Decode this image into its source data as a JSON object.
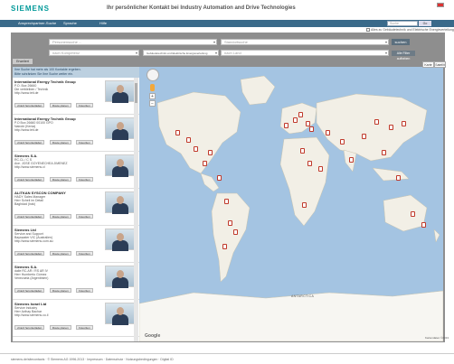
{
  "header": {
    "logo": "SIEMENS",
    "tagline": "Ihr persönlicher Kontakt bei Industry Automation and Drive Technologies"
  },
  "nav": {
    "items": [
      "Ansprechpartner-Suche",
      "Sprache",
      "Hilfe"
    ],
    "search_placeholder": "Suche",
    "search_button": "Go"
  },
  "subbar": {
    "items": [
      "Alles zu Gebäudetechnik und Elektrische Energieverteilung"
    ]
  },
  "search": {
    "name_placeholder": "Personensuche ...",
    "location_placeholder": "Standortsuche",
    "search_button": "suchen",
    "product_filter": "nach Kompetenz",
    "sector_filter": "Gebäudetechnik und Elektrische Energieverteilung",
    "country_filter": "nach Land",
    "reset_button": "Alle Filter aufheben",
    "advanced_tab": "Erweitert"
  },
  "results": {
    "notice_line1": "Ihre Suche hat mehr als 100 Kontakte ergeben.",
    "notice_line2": "Bitte schränken Sie Ihre Suche weiter ein.",
    "entries": [
      {
        "name": "International Energy Technik Group",
        "line1": "P.O. Box 26660",
        "line2": "Die verbleiben / Technik",
        "web": "http://www.ieti.de",
        "actions": [
          "vCard herunterladen",
          "Route planen",
          "Favoriten"
        ]
      },
      {
        "name": "International Energy Technik Group",
        "line1": "P.O Box 26660 00100 GPO",
        "line2": "Nairobi (Kenia)",
        "web": "http://www.ieti.de",
        "actions": [
          "vCard herunterladen",
          "Route planen",
          "Favoriten"
        ]
      },
      {
        "name": "Siemens S.A.",
        "line1": "RC.CL / C S",
        "line2": "Ave. JOSE GOYENECHEA JIMENEZ",
        "web": "http://www.siemens.cl",
        "actions": [
          "vCard herunterladen",
          "Route planen",
          "Favoriten"
        ]
      },
      {
        "name": "ALITKAN SYSCON COMPANY",
        "line1": "HADY Sales Manager",
        "line2": "Herr Scheil im Detail",
        "web": "Baghdad (Irak)",
        "actions": [
          "vCard herunterladen",
          "Route planen",
          "Favoriten"
        ]
      },
      {
        "name": "Siemens Ltd",
        "line1": "Service and Support",
        "line2": "Bayswater VIC (Australien)",
        "web": "http://www.siemens.com.au",
        "actions": [
          "vCard herunterladen",
          "Route planen",
          "Favoriten"
        ]
      },
      {
        "name": "Siemens S.A.",
        "line1": "dalle RC.AR / RS AR IV",
        "line2": "Herr Humberto Gómez",
        "web": "Venezuela (Argentinien)",
        "actions": [
          "vCard herunterladen",
          "Route planen",
          "Favoriten"
        ]
      },
      {
        "name": "Siemens Israel Ltd",
        "line1": "Service Industry",
        "line2": "Herr Avihay Bachar",
        "web": "http://www.siemens.co.il",
        "actions": [
          "vCard herunterladen",
          "Route planen",
          "Favoriten"
        ]
      }
    ]
  },
  "map": {
    "type_buttons": [
      "Karte",
      "Satellit"
    ],
    "labels": [
      "ANTARCTICA"
    ],
    "brand": "Google",
    "terms": "Kartendaten ©2013"
  },
  "footer": {
    "text": "siemens.de/sitecontacts  ·  © Siemens AG 1996-2013  ·  Impressum  ·  Datenschutz  ·  Nutzungsbedingungen  ·  Digital ID"
  }
}
